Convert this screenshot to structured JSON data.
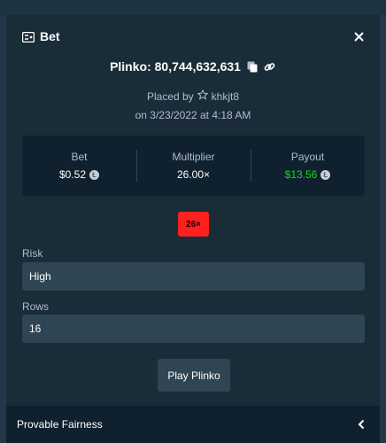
{
  "modal": {
    "title": "Bet",
    "game_id": "Plinko: 80,744,632,631",
    "placed_by_label": "Placed by",
    "username": "khkjt8",
    "date": "on 3/23/2022 at 4:18 AM"
  },
  "stats": {
    "bet_label": "Bet",
    "bet_value": "$0.52",
    "multiplier_label": "Multiplier",
    "multiplier_value": "26.00×",
    "payout_label": "Payout",
    "payout_value": "$13.56"
  },
  "result_badge": "26×",
  "fields": {
    "risk_label": "Risk",
    "risk_value": "High",
    "rows_label": "Rows",
    "rows_value": "16"
  },
  "play_button": "Play Plinko",
  "footer": {
    "label": "Provable Fairness"
  },
  "colors": {
    "modal_bg": "#1a2c38",
    "panel_bg": "#0f212e",
    "field_bg": "#2f4553",
    "payout_green": "#00e701",
    "badge_red": "#ff2020"
  },
  "icons": {
    "title": "ticket-icon",
    "close": "close-icon",
    "copy": "copy-icon",
    "link": "link-icon",
    "user": "star-icon",
    "coin": "litecoin-icon",
    "footer": "chevron-left-icon"
  }
}
